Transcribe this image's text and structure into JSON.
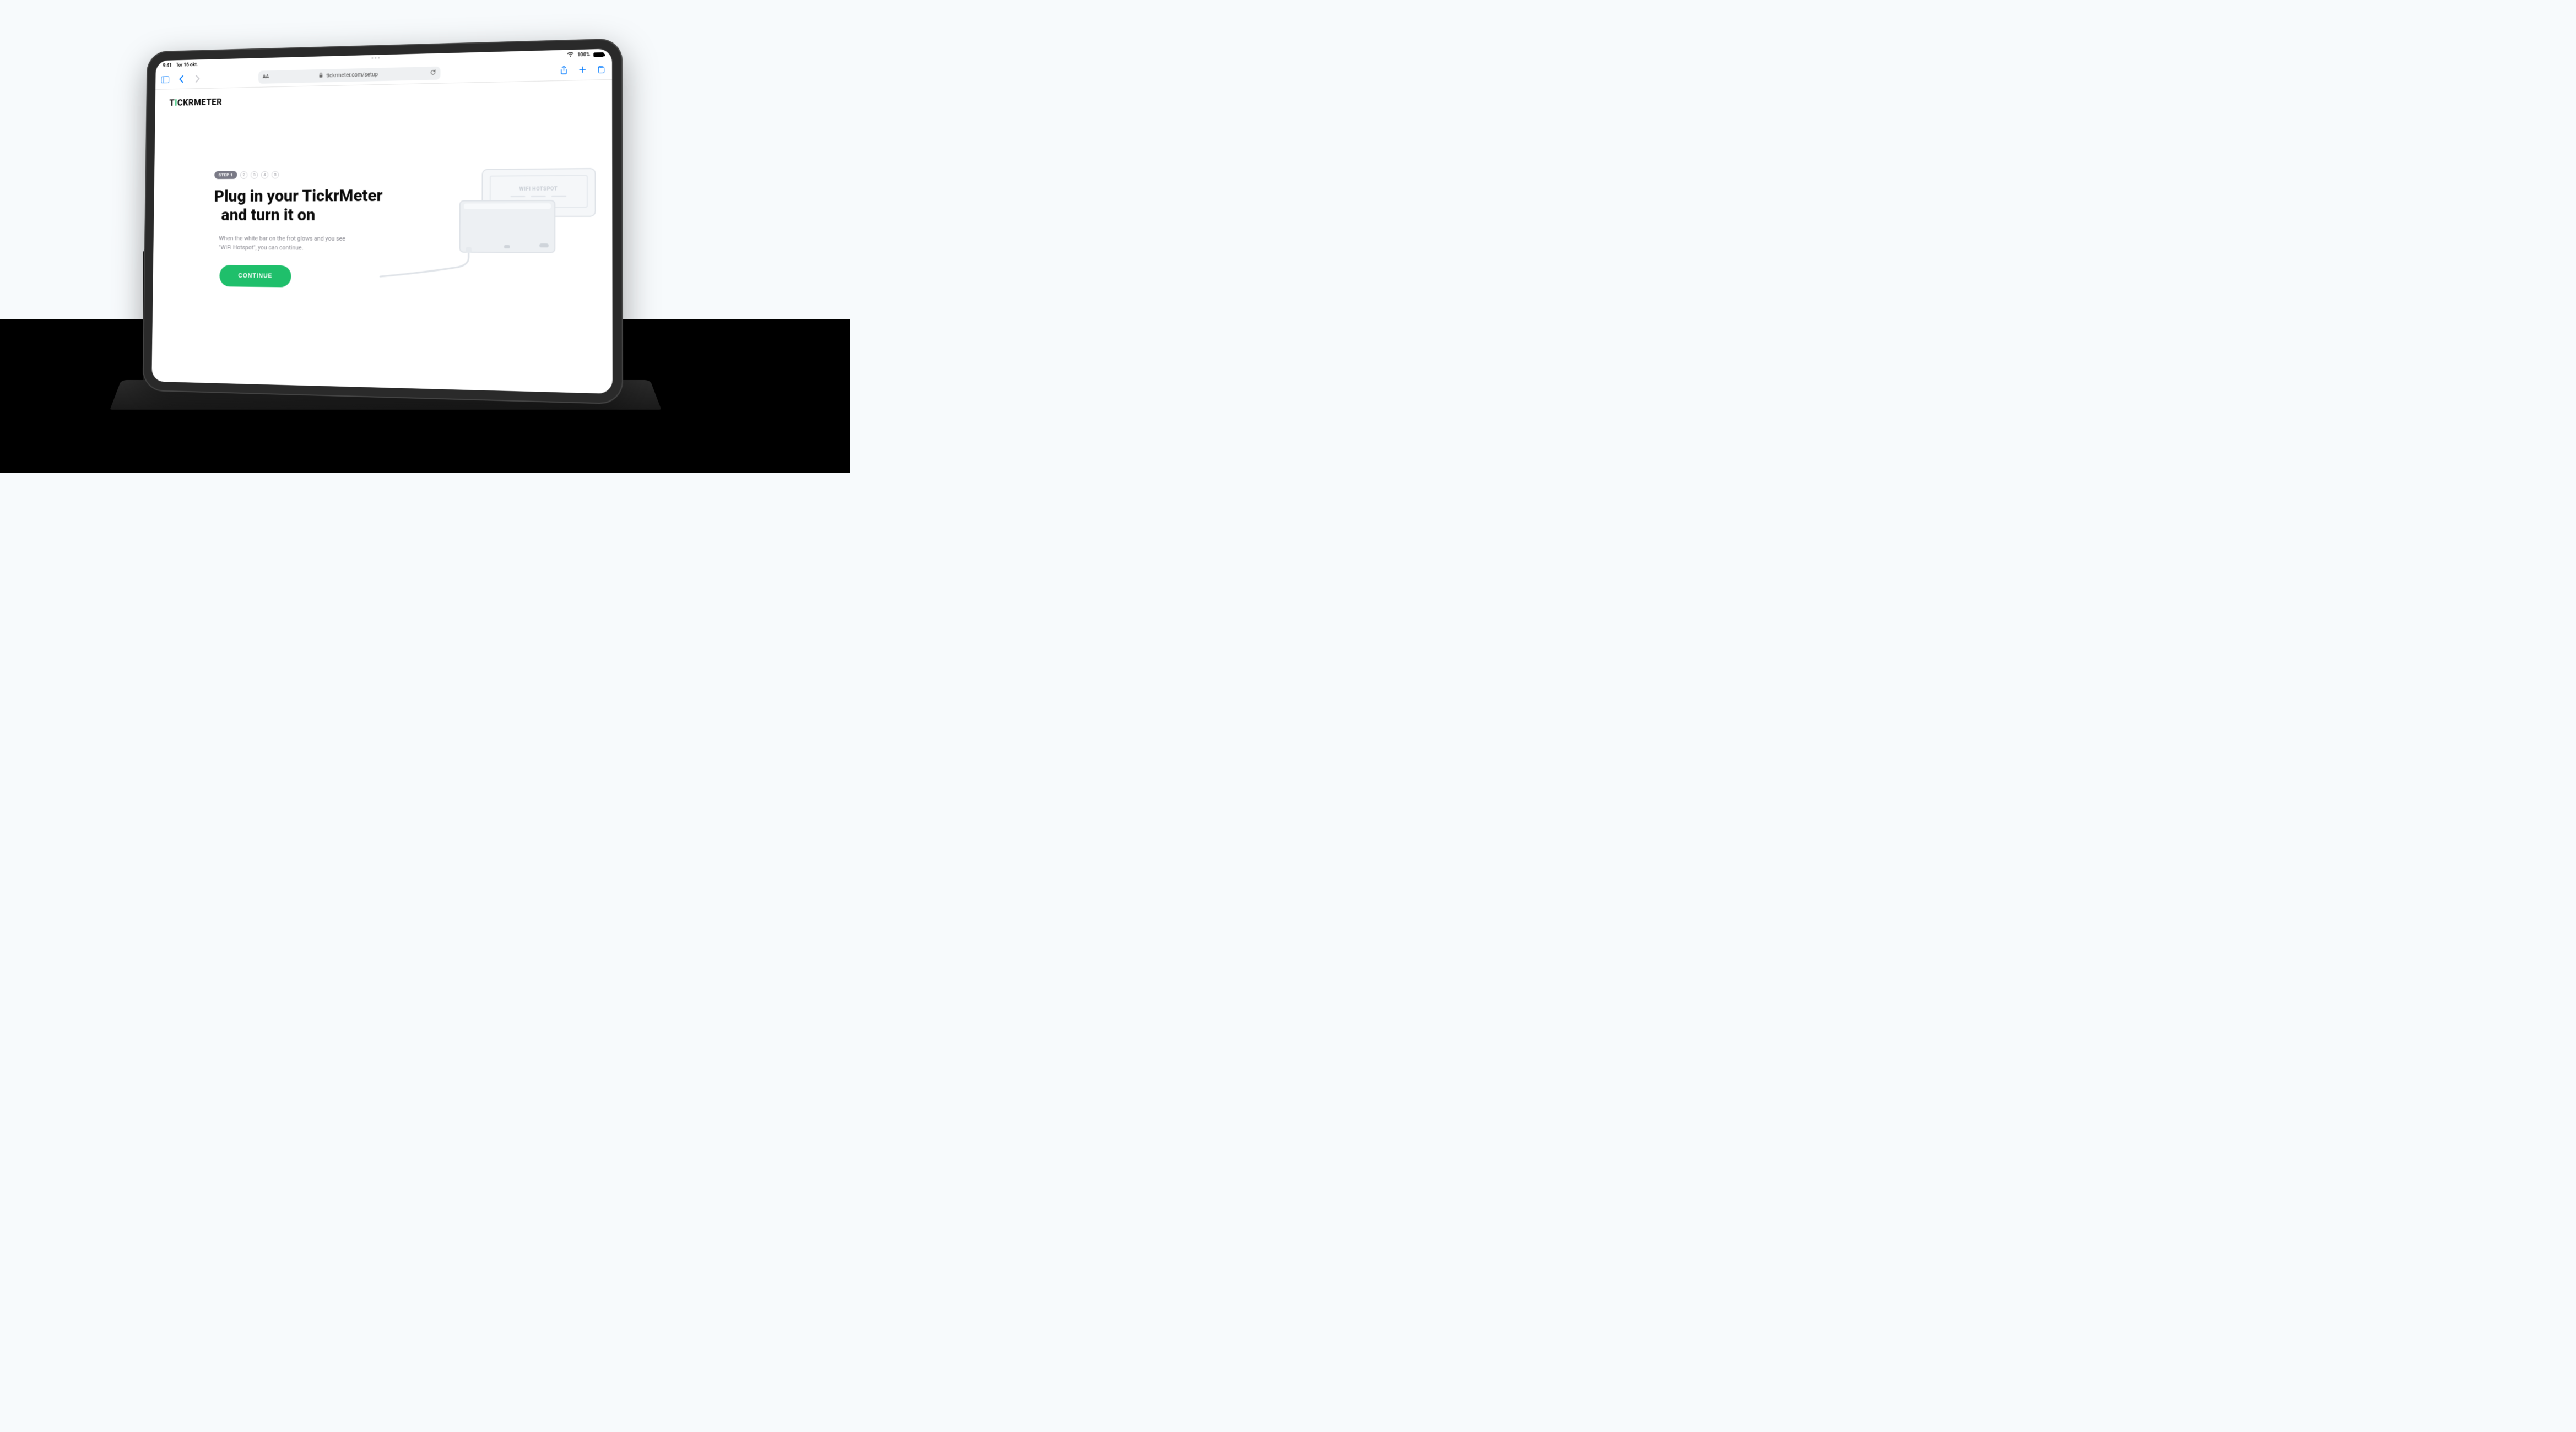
{
  "status": {
    "time": "9:41",
    "date": "Tor 16 okt.",
    "battery_pct": "100%"
  },
  "browser": {
    "url": "tickrmeter.com/setup",
    "text_size_label": "AA"
  },
  "logo": {
    "pre": "T",
    "accent": "I",
    "post": "CKRMETER"
  },
  "steps": {
    "current_label": "STEP 1",
    "others": [
      "2",
      "3",
      "4",
      "5"
    ]
  },
  "headline": {
    "line1": "Plug in your TickrMeter",
    "line2": "and turn it on"
  },
  "description": "When the white bar on the frot glows and you see \"WiFi Hotspot\", you can continue.",
  "cta_label": "CONTINUE",
  "illustration": {
    "device_text": "WIFI HOTSPOT"
  },
  "colors": {
    "accent": "#1fbf6b",
    "ios_blue": "#007aff"
  }
}
